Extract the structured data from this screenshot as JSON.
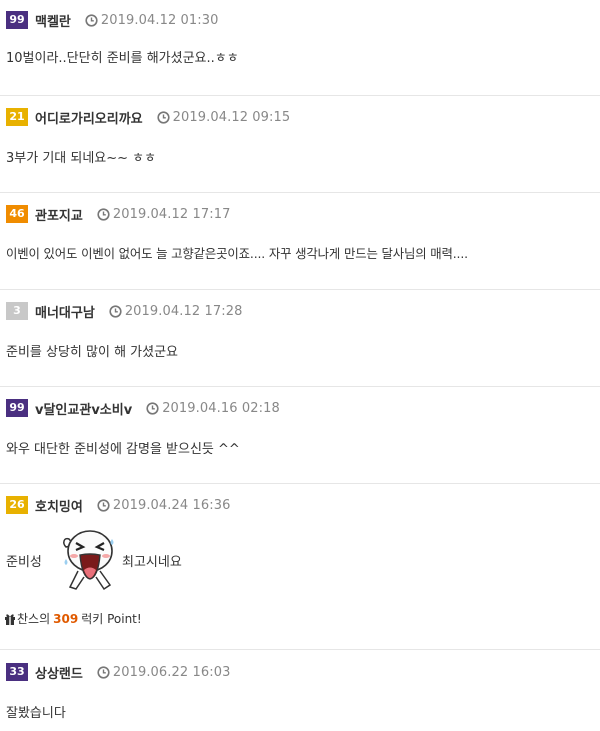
{
  "comments": [
    {
      "level": "99",
      "level_color": "#4a2f80",
      "nick": "맥켈란",
      "date": "2019.04.12 01:30",
      "text": "10벌이라..단단히 준비를 해가셨군요..ㅎㅎ"
    },
    {
      "level": "21",
      "level_color": "#e8b100",
      "nick": "어디로가리오리까요",
      "date": "2019.04.12 09:15",
      "text": "3부가 기대 되네요~~ ㅎㅎ"
    },
    {
      "level": "46",
      "level_color": "#f08c00",
      "nick": "관포지교",
      "date": "2019.04.12 17:17",
      "text": "이벤이 있어도 이벤이 없어도 늘 고향같은곳이죠.... 자꾸 생각나게 만드는 달사님의 매력...."
    },
    {
      "level": "3",
      "level_color": "#c8c8c8",
      "nick": "매너대구남",
      "date": "2019.04.12 17:28",
      "text": "준비를 상당히 많이 해 가셨군요"
    },
    {
      "level": "99",
      "level_color": "#4a2f80",
      "nick": "v달인교관v소비v",
      "date": "2019.04.16 02:18",
      "text": "와우 대단한 준비성에 감명을 받으신듯 ^^"
    },
    {
      "level": "26",
      "level_color": "#e8b100",
      "nick": "호치밍여",
      "date": "2019.04.24 16:36",
      "text_before": "준비성",
      "text_after": "최고시네요",
      "emoticon": "laughing-face-icon",
      "lucky": {
        "prefix": "찬스의",
        "number": "309",
        "suffix": "럭키 Point!"
      }
    },
    {
      "level": "33",
      "level_color": "#4a2f80",
      "nick": "상상랜드",
      "date": "2019.06.22 16:03",
      "text": "잘봤습니다"
    }
  ]
}
